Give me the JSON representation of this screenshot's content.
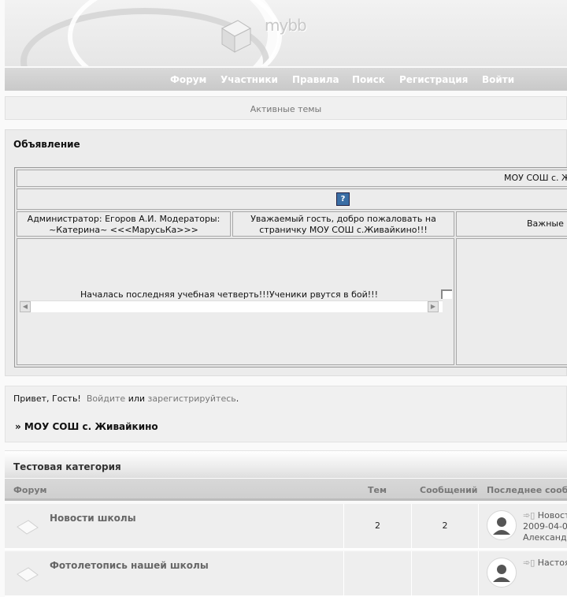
{
  "header": {
    "logo_text": "mybb"
  },
  "nav": {
    "items": [
      "Форум",
      "Участники",
      "Правила",
      "Поиск",
      "Регистрация",
      "Войти"
    ]
  },
  "active_topics": "Активные темы",
  "announcement": {
    "title": "Объявление",
    "school_name": "МОУ СОШ с. Жи",
    "admin_text": "Администратор: Егоров А.И. Модераторы: ~Катерина~ <<<МарусьКа>>>",
    "welcome_text": "Уважаемый гость, добро пожаловать на страничку МОУ СОШ с.Живайкино!!!",
    "important_text": "Важные с",
    "marquee_text": "Началась последняя учебная четверть!!!Ученики рвутся в бой!!!",
    "help_symbol": "?"
  },
  "greeting": {
    "hello": "Привет, Гость!",
    "login": "Войдите",
    "or": "или",
    "register": "зарегистрируйтесь",
    "period": "."
  },
  "breadcrumb": "» МОУ СОШ с. Живайкино",
  "category": {
    "title": "Тестовая категория",
    "columns": [
      "Форум",
      "Тем",
      "Сообщений",
      "Последнее сооб"
    ],
    "forums": [
      {
        "name": "Новости школы",
        "topics": "2",
        "posts": "2",
        "last_post": [
          "Новост",
          "2009-04-0",
          "Александ"
        ]
      },
      {
        "name": "Фотолетопись нашей школы",
        "topics": "",
        "posts": "",
        "last_post": [
          "Настоя"
        ]
      }
    ]
  },
  "colors": {
    "nav_bg": "#cfcfcf",
    "link_grey": "#777777",
    "help_icon": "#3a6ea5"
  }
}
